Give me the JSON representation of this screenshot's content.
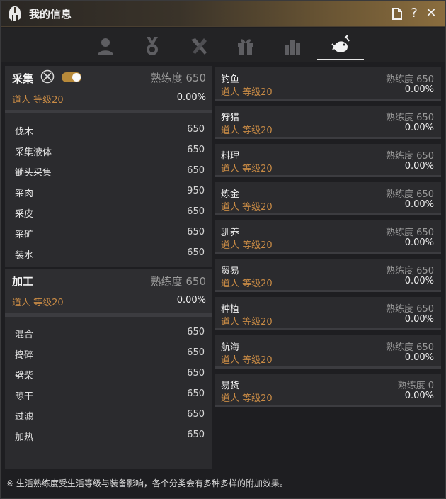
{
  "window": {
    "title": "我的信息"
  },
  "tabs": [
    {
      "name": "profile",
      "icon": "person-icon"
    },
    {
      "name": "medal",
      "icon": "medal-icon"
    },
    {
      "name": "tools",
      "icon": "tools-icon"
    },
    {
      "name": "gift",
      "icon": "gift-icon"
    },
    {
      "name": "stats",
      "icon": "bar-chart-icon"
    },
    {
      "name": "life-skills",
      "icon": "fish-hook-icon",
      "active": true
    }
  ],
  "gathering": {
    "title": "采集",
    "proficiency_label": "熟练度 650",
    "grade": "道人 等级20",
    "percent": "0.00%",
    "subs": [
      {
        "name": "伐木",
        "value": "650"
      },
      {
        "name": "采集液体",
        "value": "650"
      },
      {
        "name": "锄头采集",
        "value": "650"
      },
      {
        "name": "采肉",
        "value": "950"
      },
      {
        "name": "采皮",
        "value": "650"
      },
      {
        "name": "采矿",
        "value": "650"
      },
      {
        "name": "装水",
        "value": "650"
      }
    ]
  },
  "processing": {
    "title": "加工",
    "proficiency_label": "熟练度 650",
    "grade": "道人 等级20",
    "percent": "0.00%",
    "subs": [
      {
        "name": "混合",
        "value": "650"
      },
      {
        "name": "捣碎",
        "value": "650"
      },
      {
        "name": "劈柴",
        "value": "650"
      },
      {
        "name": "晾干",
        "value": "650"
      },
      {
        "name": "过滤",
        "value": "650"
      },
      {
        "name": "加热",
        "value": "650"
      }
    ]
  },
  "skills": [
    {
      "name": "钓鱼",
      "proficiency": "熟练度 650",
      "grade": "道人 等级20",
      "percent": "0.00%"
    },
    {
      "name": "狩猎",
      "proficiency": "熟练度 650",
      "grade": "道人 等级20",
      "percent": "0.00%"
    },
    {
      "name": "料理",
      "proficiency": "熟练度 650",
      "grade": "道人 等级20",
      "percent": "0.00%"
    },
    {
      "name": "炼金",
      "proficiency": "熟练度 650",
      "grade": "道人 等级20",
      "percent": "0.00%"
    },
    {
      "name": "驯养",
      "proficiency": "熟练度 650",
      "grade": "道人 等级20",
      "percent": "0.00%"
    },
    {
      "name": "贸易",
      "proficiency": "熟练度 650",
      "grade": "道人 等级20",
      "percent": "0.00%"
    },
    {
      "name": "种植",
      "proficiency": "熟练度 650",
      "grade": "道人 等级20",
      "percent": "0.00%"
    },
    {
      "name": "航海",
      "proficiency": "熟练度 650",
      "grade": "道人 等级20",
      "percent": "0.00%"
    },
    {
      "name": "易货",
      "proficiency": "熟练度 0",
      "grade": "道人 等级20",
      "percent": "0.00%"
    }
  ],
  "footer": {
    "note": "※ 生活熟练度受生活等级与装备影响，各个分类会有多种多样的附加效果。"
  },
  "colors": {
    "accent": "#c98b45",
    "toggle": "#b88a3a",
    "panel": "#2b2b2e"
  }
}
